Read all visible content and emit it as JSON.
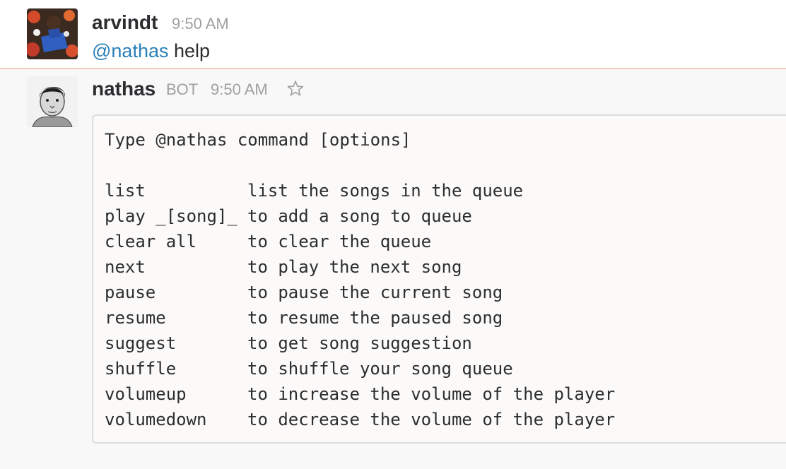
{
  "messages": [
    {
      "sender": "arvindt",
      "time": "9:50 AM",
      "mention": "@nathas",
      "text": " help"
    },
    {
      "sender": "nathas",
      "bot_label": "BOT",
      "time": "9:50 AM",
      "star_icon": "star-outline-icon",
      "code": {
        "header": "Type @nathas command [options]",
        "rows": [
          {
            "command": "list",
            "description": "list the songs in the queue"
          },
          {
            "command": "play _[song]_",
            "description": "to add a song to queue"
          },
          {
            "command": "clear all",
            "description": "to clear the queue"
          },
          {
            "command": "next",
            "description": "to play the next song"
          },
          {
            "command": "pause",
            "description": "to pause the current song"
          },
          {
            "command": "resume",
            "description": "to resume the paused song"
          },
          {
            "command": "suggest",
            "description": "to get song suggestion"
          },
          {
            "command": "shuffle",
            "description": "to shuffle your song queue"
          },
          {
            "command": "volumeup",
            "description": "to increase the volume of the player"
          },
          {
            "command": "volumedown",
            "description": "to decrease the volume of the player"
          }
        ]
      }
    }
  ],
  "colors": {
    "mention": "#2a80b9",
    "divider": "#f4c8b8",
    "meta_text": "#a0a0a2"
  }
}
